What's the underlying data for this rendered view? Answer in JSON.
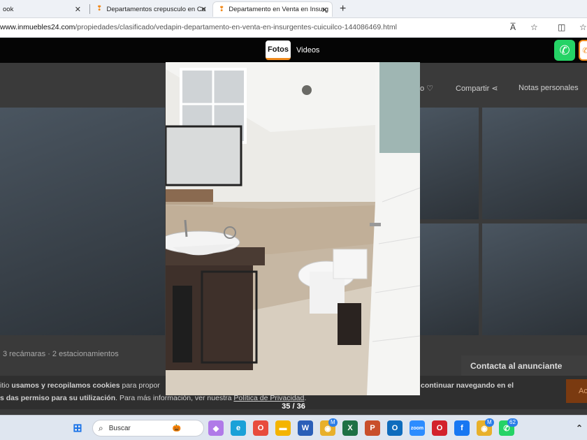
{
  "browser": {
    "tabs": [
      {
        "label": "ook"
      },
      {
        "label": "Departamentos crepusculo en Co"
      },
      {
        "label": "Departamento en Venta en Insurg"
      }
    ],
    "url_prefix": "www.inmuebles24.com",
    "url_path": "/propiedades/clasificado/vedapin-departamento-en-venta-en-insurgentes-cuicuilco-144086469.html",
    "read_aloud": "A̅",
    "new_tab": "+"
  },
  "gallery": {
    "tab_photos": "Fotos",
    "tab_videos": "Videos",
    "counter": "35 / 36"
  },
  "listing": {
    "favorite_fragment": "o",
    "share": "Compartir",
    "notes": "Notas personales",
    "specs": "3 recámaras · 2 estacionamientos",
    "contact": "Contacta al anunciante"
  },
  "cookie": {
    "line1_a": "itio ",
    "line1_b": "usamos y recopilamos cookies",
    "line1_c": " para propor",
    "line1_right": "continuar navegando en el",
    "line2_a": "s das permiso para su utilización",
    "line2_b": ". Para más información, ver nuestra ",
    "line2_link": "Política de Privacidad",
    "line2_end": ".",
    "accept_fragment": "Ac"
  },
  "taskbar": {
    "search_label": "Buscar",
    "badge_count": "62",
    "badge_m1": "M",
    "badge_m2": "M"
  },
  "colors": {
    "accent": "#f08a1c",
    "whatsapp": "#25d366"
  }
}
